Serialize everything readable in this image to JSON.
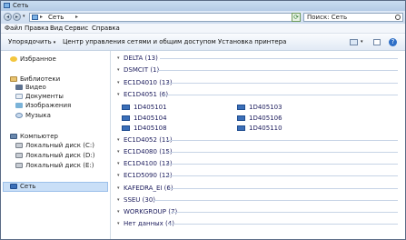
{
  "window": {
    "title": "Сеть"
  },
  "address": {
    "location": "Сеть",
    "separator": "▸",
    "search_placeholder": "Поиск: Сеть"
  },
  "menu": {
    "items": [
      "Файл",
      "Правка",
      "Вид",
      "Сервис",
      "Справка"
    ]
  },
  "toolbar": {
    "organize": "Упорядочить",
    "network_center": "Центр управления сетями и общим доступом",
    "install_printer": "Установка принтера"
  },
  "nav": {
    "favorites": "Избранное",
    "libraries": "Библиотеки",
    "lib_items": [
      "Видео",
      "Документы",
      "Изображения",
      "Музыка"
    ],
    "computer": "Компьютер",
    "disks": [
      "Локальный диск (C:)",
      "Локальный диск (D:)",
      "Локальный диск (E:)"
    ],
    "network": "Сеть"
  },
  "groups": [
    {
      "label": "DELTA (13)"
    },
    {
      "label": "DSMCIT (1)"
    },
    {
      "label": "EC1D4010 (13)"
    },
    {
      "label": "EC1D4051 (6)"
    },
    {
      "label": "EC1D4052 (11)"
    },
    {
      "label": "EC1D4080 (15)"
    },
    {
      "label": "EC1D4100 (13)"
    },
    {
      "label": "EC1D5090 (12)"
    },
    {
      "label": "KAFEDRA_EI (6)"
    },
    {
      "label": "SSEU (30)"
    },
    {
      "label": "WORKGROUP (7)"
    },
    {
      "label": "Нет данных (4)"
    }
  ],
  "computers": [
    "1D405101",
    "1D405103",
    "1D405104",
    "1D405106",
    "1D405108",
    "1D405110"
  ]
}
